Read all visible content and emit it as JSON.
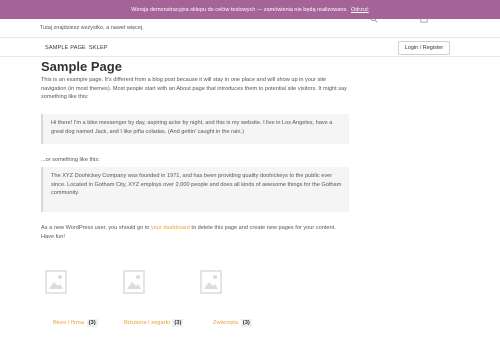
{
  "notice": {
    "text": "Wersja demonstracyjna sklepu do celów testowych — zamówienia nie będą realizowane.",
    "dismiss": "Odrzuć"
  },
  "header": {
    "tagline": "Tutaj znajdziesz wszystko, a nawet więcej."
  },
  "nav": {
    "items": [
      "SAMPLE PAGE",
      "SKLEP"
    ],
    "login_label": "Login / Register"
  },
  "page": {
    "title": "Sample Page",
    "intro": "This is an example page. It's different from a blog post because it will stay in one place and will show up in your site navigation (in most themes). Most people start with an About page that introduces them to potential site visitors. It might say something like this:",
    "quote1": "Hi there! I'm a bike messenger by day, aspiring actor by night, and this is my website. I live in Los Angeles, have a great dog named Jack, and I like piña coladas. (And gettin' caught in the rain.)",
    "or_text": "...or something like this:",
    "quote2": "The XYZ Doohickey Company was founded in 1971, and has been providing quality doohickeys to the public ever since. Located in Gotham City, XYZ employs over 2,000 people and does all kinds of awesome things for the Gotham community.",
    "outro_before": "As a new WordPress user, you should go to ",
    "outro_link": "your dashboard",
    "outro_after": " to delete this page and create new pages for your content. Have fun!"
  },
  "categories": [
    {
      "name": "Biuro i firma",
      "count": "(3)"
    },
    {
      "name": "Biżuteria i zegarki",
      "count": "(3)"
    },
    {
      "name": "Zwierzęta",
      "count": "(3)"
    }
  ],
  "colors": {
    "notice_bg": "#a46497",
    "link": "#e8a13a"
  },
  "icons": {
    "search": "search-icon",
    "cart": "cart-icon",
    "placeholder": "image-placeholder-icon"
  }
}
